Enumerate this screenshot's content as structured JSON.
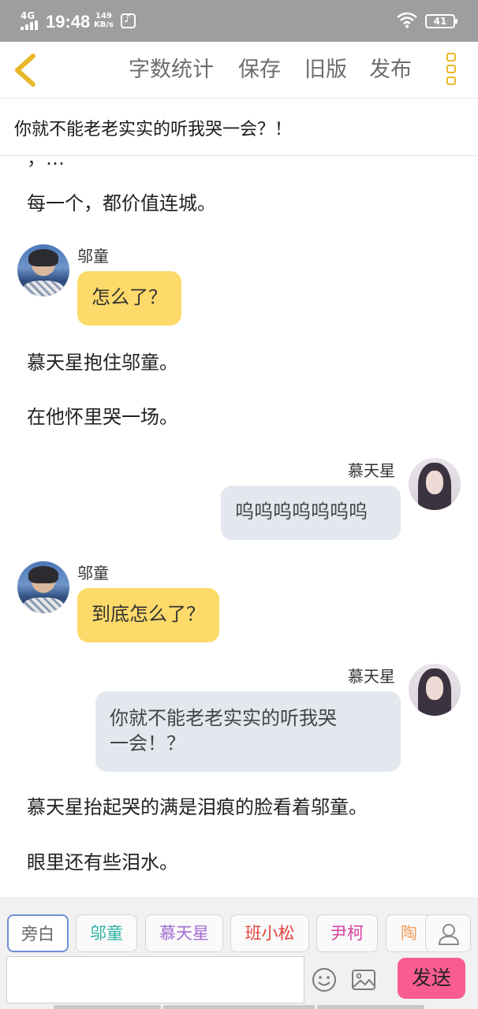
{
  "status_bar": {
    "network": "4G",
    "time": "19:48",
    "speed_value": "149",
    "speed_unit": "KB/s",
    "battery": "41",
    "icons": [
      "signal-icon",
      "music-icon",
      "wifi-icon",
      "battery-icon"
    ]
  },
  "toolbar": {
    "back_icon": "chevron-left-icon",
    "word_count": "字数统计",
    "save": "保存",
    "old_version": "旧版",
    "publish": "发布",
    "more_icon": "more-vertical-icon",
    "accent_color": "#e8b929"
  },
  "title": "你就不能老老实实的听我哭一会？！",
  "content": {
    "cut_text": "，…",
    "narration_1": "每一个，都价值连城。",
    "msg_1": {
      "speaker": "邬童",
      "text": "怎么了？"
    },
    "narration_2": "慕天星抱住邬童。",
    "narration_3": "在他怀里哭一场。",
    "msg_2": {
      "speaker": "慕天星",
      "text": "呜呜呜呜呜呜呜"
    },
    "msg_3": {
      "speaker": "邬童",
      "text": "到底怎么了？"
    },
    "msg_4": {
      "speaker": "慕天星",
      "line1": "你就不能老老实实的听我哭",
      "line2": "一会！？"
    },
    "narration_4": "慕天星抬起哭的满是泪痕的脸看着邬童。",
    "narration_5": "眼里还有些泪水。"
  },
  "roles": [
    {
      "label": "旁白",
      "color": "#666666"
    },
    {
      "label": "邬童",
      "color": "#2bb3a3"
    },
    {
      "label": "慕天星",
      "color": "#a26bd1"
    },
    {
      "label": "班小松",
      "color": "#e0443c"
    },
    {
      "label": "尹柯",
      "color": "#d6409f"
    },
    {
      "label": "陶西",
      "color": "#f0a060"
    }
  ],
  "composer": {
    "input_value": "",
    "emoji_icon": "emoji-icon",
    "image_icon": "image-icon",
    "send": "发送",
    "send_color": "#f95d8f"
  }
}
